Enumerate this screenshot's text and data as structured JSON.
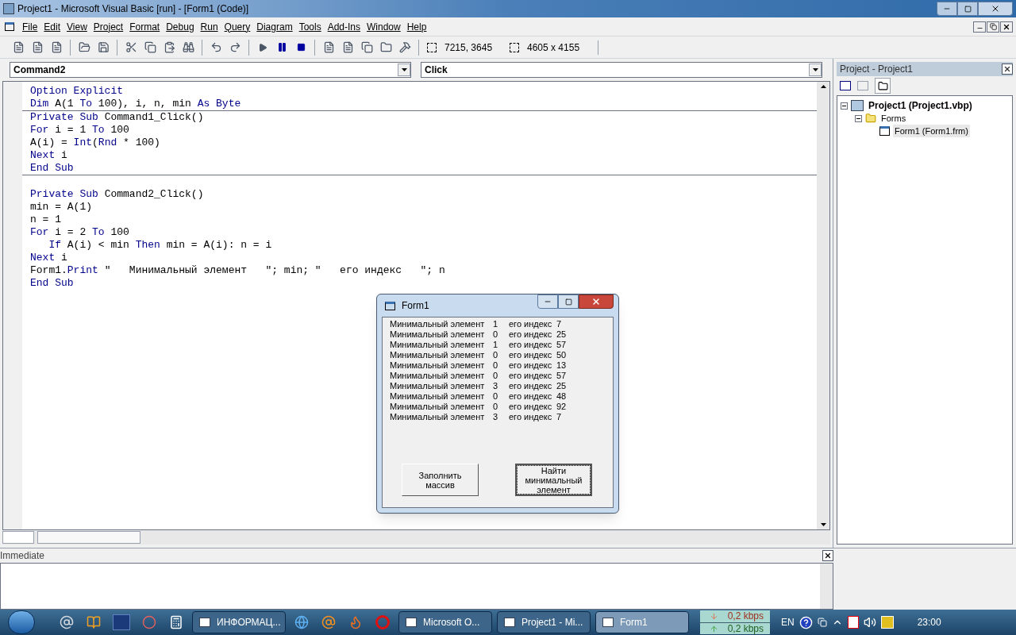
{
  "window": {
    "title": "Project1 - Microsoft Visual Basic [run] - [Form1 (Code)]"
  },
  "menu": [
    "File",
    "Edit",
    "View",
    "Project",
    "Format",
    "Debug",
    "Run",
    "Query",
    "Diagram",
    "Tools",
    "Add-Ins",
    "Window",
    "Help"
  ],
  "toolbar": {
    "position": "7215, 3645",
    "size": "4605 x 4155"
  },
  "code_window": {
    "object_combo": "Command2",
    "procedure_combo": "Click",
    "procedures": [
      {
        "lines": [
          [
            {
              "kind": "keyword",
              "text": "Option Explicit"
            }
          ],
          [
            {
              "kind": "keyword",
              "text": "Dim"
            },
            {
              "kind": "plain",
              "text": " A(1 "
            },
            {
              "kind": "keyword",
              "text": "To"
            },
            {
              "kind": "plain",
              "text": " 100), i, n, min "
            },
            {
              "kind": "keyword",
              "text": "As Byte"
            }
          ]
        ]
      },
      {
        "lines": [
          [
            {
              "kind": "keyword",
              "text": "Private Sub"
            },
            {
              "kind": "plain",
              "text": " Command1_Click()"
            }
          ],
          [
            {
              "kind": "keyword",
              "text": "For"
            },
            {
              "kind": "plain",
              "text": " i = 1 "
            },
            {
              "kind": "keyword",
              "text": "To"
            },
            {
              "kind": "plain",
              "text": " 100"
            }
          ],
          [
            {
              "kind": "plain",
              "text": "A(i) = "
            },
            {
              "kind": "keyword",
              "text": "Int"
            },
            {
              "kind": "plain",
              "text": "("
            },
            {
              "kind": "keyword",
              "text": "Rnd"
            },
            {
              "kind": "plain",
              "text": " * 100)"
            }
          ],
          [
            {
              "kind": "keyword",
              "text": "Next"
            },
            {
              "kind": "plain",
              "text": " i"
            }
          ],
          [
            {
              "kind": "keyword",
              "text": "End Sub"
            }
          ]
        ]
      },
      {
        "lines": [
          [
            {
              "kind": "keyword",
              "text": "Private Sub"
            },
            {
              "kind": "plain",
              "text": " Command2_Click()"
            }
          ],
          [
            {
              "kind": "plain",
              "text": "min = A(1)"
            }
          ],
          [
            {
              "kind": "plain",
              "text": "n = 1"
            }
          ],
          [
            {
              "kind": "keyword",
              "text": "For"
            },
            {
              "kind": "plain",
              "text": " i = 2 "
            },
            {
              "kind": "keyword",
              "text": "To"
            },
            {
              "kind": "plain",
              "text": " 100"
            }
          ],
          [
            {
              "kind": "keyword",
              "text": "If",
              "indent": true
            },
            {
              "kind": "plain",
              "text": " A(i) < min "
            },
            {
              "kind": "keyword",
              "text": "Then"
            },
            {
              "kind": "plain",
              "text": " min = A(i): n = i"
            }
          ],
          [
            {
              "kind": "keyword",
              "text": "Next"
            },
            {
              "kind": "plain",
              "text": " i"
            }
          ],
          [
            {
              "kind": "plain",
              "text": "Form1."
            },
            {
              "kind": "keyword",
              "text": "Print"
            },
            {
              "kind": "plain",
              "text": " \"   Минимальный элемент   \"; min; \"   его индекс   \"; n"
            }
          ],
          [
            {
              "kind": "keyword",
              "text": "End Sub"
            }
          ]
        ]
      }
    ]
  },
  "project_panel": {
    "title": "Project - Project1",
    "tree": [
      {
        "label": "Project1 (Project1.vbp)",
        "expanded": true,
        "children": [
          {
            "label": "Forms",
            "expanded": true,
            "children": [
              {
                "label": "Form1 (Form1.frm)",
                "selected": true
              }
            ]
          }
        ]
      }
    ]
  },
  "form_window": {
    "title": "Form1",
    "output": [
      {
        "label": "Минимальный элемент",
        "min": "1",
        "label2": "его индекс",
        "index": "7"
      },
      {
        "label": "Минимальный элемент",
        "min": "0",
        "label2": "его индекс",
        "index": "25"
      },
      {
        "label": "Минимальный элемент",
        "min": "1",
        "label2": "его индекс",
        "index": "57"
      },
      {
        "label": "Минимальный элемент",
        "min": "0",
        "label2": "его индекс",
        "index": "50"
      },
      {
        "label": "Минимальный элемент",
        "min": "0",
        "label2": "его индекс",
        "index": "13"
      },
      {
        "label": "Минимальный элемент",
        "min": "0",
        "label2": "его индекс",
        "index": "57"
      },
      {
        "label": "Минимальный элемент",
        "min": "3",
        "label2": "его индекс",
        "index": "25"
      },
      {
        "label": "Минимальный элемент",
        "min": "0",
        "label2": "его индекс",
        "index": "48"
      },
      {
        "label": "Минимальный элемент",
        "min": "0",
        "label2": "его индекс",
        "index": "92"
      },
      {
        "label": "Минимальный элемент",
        "min": "3",
        "label2": "его индекс",
        "index": "7"
      }
    ],
    "buttons": [
      {
        "label": "Заполнить массив",
        "focused": false
      },
      {
        "label": "Найти минимальный элемент",
        "focused": true
      }
    ]
  },
  "immediate": {
    "title": "Immediate"
  },
  "taskbar": {
    "tasks": [
      {
        "label": "ИНФОРМАЦ...",
        "selected": false
      },
      {
        "label": "Microsoft O...",
        "selected": false
      },
      {
        "label": "Project1 - Mi...",
        "selected": false
      },
      {
        "label": "Form1",
        "selected": true
      }
    ],
    "network": {
      "down": "0,2 kbps",
      "up": "0,2 kbps"
    },
    "language": "EN",
    "clock": "23:00"
  }
}
